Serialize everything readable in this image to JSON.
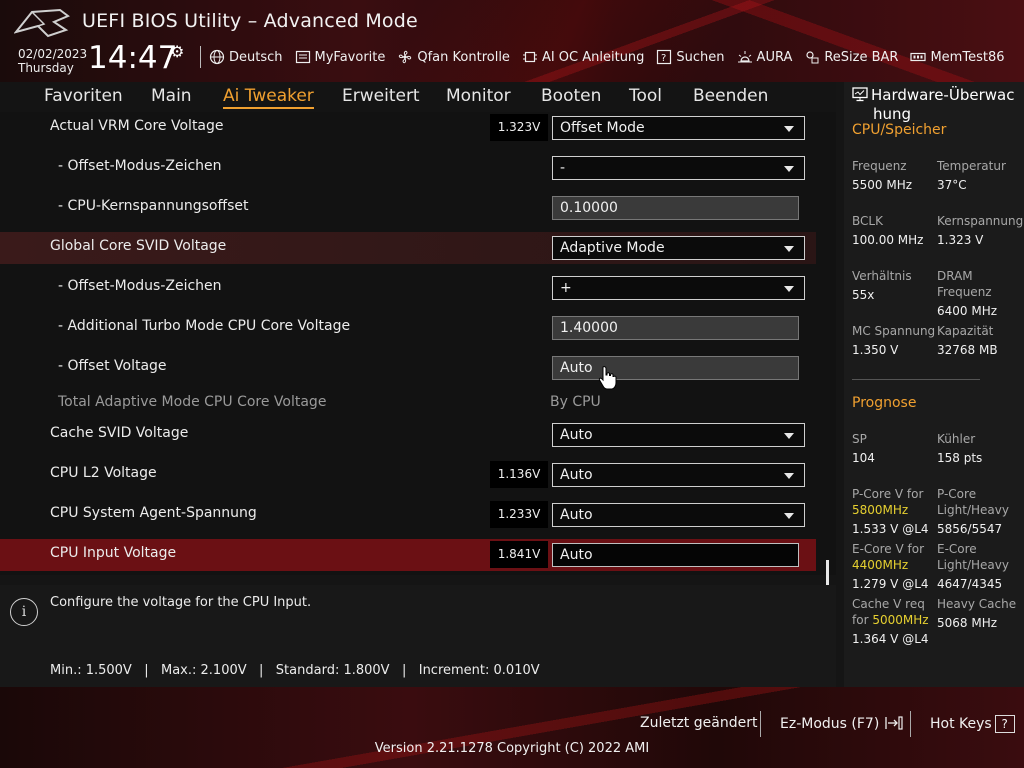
{
  "header": {
    "title": "UEFI BIOS Utility – Advanced Mode",
    "date": "02/02/2023",
    "weekday": "Thursday",
    "time": "14:47",
    "toolbar": [
      "Deutsch",
      "MyFavorite",
      "Qfan Kontrolle",
      "AI OC Anleitung",
      "Suchen",
      "AURA",
      "ReSize BAR",
      "MemTest86"
    ]
  },
  "nav": {
    "tabs": [
      "Favoriten",
      "Main",
      "Ai Tweaker",
      "Erweitert",
      "Monitor",
      "Booten",
      "Tool",
      "Beenden"
    ],
    "active": "Ai Tweaker"
  },
  "settings": [
    {
      "label": "Actual VRM Core Voltage",
      "voltage": "1.323V",
      "value": "Offset Mode",
      "control": "dropdown"
    },
    {
      "label": "- Offset-Modus-Zeichen",
      "value": "-",
      "control": "dropdown"
    },
    {
      "label": "- CPU-Kernspannungsoffset",
      "value": "0.10000",
      "control": "text"
    },
    {
      "label": "Global Core SVID Voltage",
      "value": "Adaptive Mode",
      "control": "dropdown"
    },
    {
      "label": "- Offset-Modus-Zeichen",
      "value": "+",
      "control": "dropdown"
    },
    {
      "label": "- Additional Turbo Mode CPU Core Voltage",
      "value": "1.40000",
      "control": "text"
    },
    {
      "label": "- Offset Voltage",
      "value": "Auto",
      "control": "text"
    },
    {
      "label": "Total Adaptive Mode CPU Core Voltage",
      "value": "By CPU",
      "control": "readonly"
    },
    {
      "label": "Cache SVID Voltage",
      "value": "Auto",
      "control": "dropdown"
    },
    {
      "label": "CPU L2 Voltage",
      "voltage": "1.136V",
      "value": "Auto",
      "control": "dropdown"
    },
    {
      "label": "CPU System Agent-Spannung",
      "voltage": "1.233V",
      "value": "Auto",
      "control": "dropdown"
    },
    {
      "label": "CPU Input Voltage",
      "voltage": "1.841V",
      "value": "Auto",
      "control": "text"
    }
  ],
  "help": {
    "description": "Configure the voltage for the CPU Input.",
    "range": "Min.: 1.500V   |   Max.: 2.100V   |   Standard: 1.800V   |   Increment: 0.010V"
  },
  "hardware_monitor": {
    "title_line1": "Hardware-Überwac",
    "title_line2": "hung",
    "cpu_section": "CPU/Speicher",
    "frequenz_label": "Frequenz",
    "frequenz_value": "5500 MHz",
    "temperatur_label": "Temperatur",
    "temperatur_value": "37°C",
    "bclk_label": "BCLK",
    "bclk_value": "100.00 MHz",
    "kernspannung_label": "Kernspannung",
    "kernspannung_value": "1.323 V",
    "verhaeltnis_label": "Verhältnis",
    "verhaeltnis_value": "55x",
    "dram_label_1": "DRAM",
    "dram_label_2": "Frequenz",
    "dram_value": "6400 MHz",
    "mc_label": "MC Spannung",
    "mc_value": "1.350 V",
    "kapazitaet_label": "Kapazität",
    "kapazitaet_value": "32768 MB",
    "prognose_section": "Prognose",
    "sp_label": "SP",
    "sp_value": "104",
    "kuehler_label": "Kühler",
    "kuehler_value": "158 pts",
    "pcore_label": "P-Core V for",
    "pcore_freq": "5800MHz",
    "pcore_value": "1.533 V @L4",
    "pcore_lh_label_1": "P-Core",
    "pcore_lh_label_2": "Light/Heavy",
    "pcore_lh_value": "5856/5547",
    "ecore_label": "E-Core V for",
    "ecore_freq": "4400MHz",
    "ecore_value": "1.279 V @L4",
    "ecore_lh_label_1": "E-Core",
    "ecore_lh_label_2": "Light/Heavy",
    "ecore_lh_value": "4647/4345",
    "cache_label_1": "Cache V req",
    "cache_label_2": "for",
    "cache_freq": "5000MHz",
    "cache_value": "1.364 V @L4",
    "heavy_cache_label": "Heavy Cache",
    "heavy_cache_value": "5068 MHz"
  },
  "footer": {
    "last_changed": "Zuletzt geändert",
    "ez_mode": "Ez-Modus (F7)",
    "hot_keys": "Hot Keys",
    "hot_keys_key": "?",
    "version": "Version 2.21.1278 Copyright (C) 2022 AMI"
  },
  "colors": {
    "accent": "#f0a030",
    "highlight_row": "#6b1014",
    "frequency_highlight": "#e6d030"
  }
}
